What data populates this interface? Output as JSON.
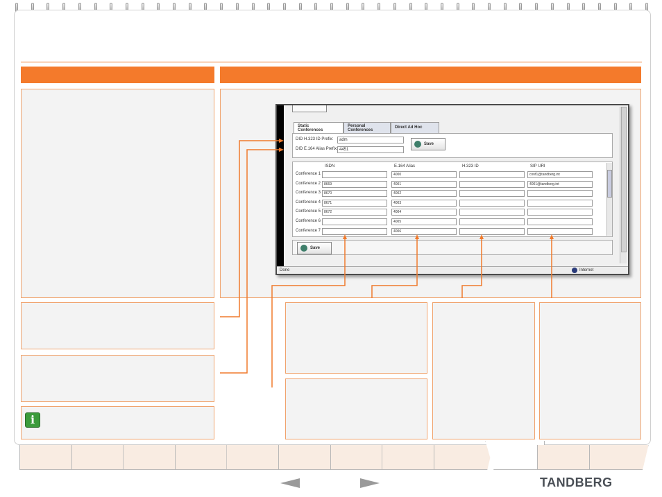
{
  "screenshot": {
    "tabs": [
      "Static\nConferences",
      "Personal\nConferences",
      "Direct Ad Hoc"
    ],
    "form": {
      "h323_label": "DID H.323 ID Prefix:",
      "h323_value": "adm",
      "e164_label": "DID E.164 Alias Prefix:",
      "e164_value": "4451"
    },
    "save_label": "Save",
    "columns": [
      "ISDN",
      "E.164 Alias",
      "H.323 ID",
      "SIP URI"
    ],
    "rows": [
      {
        "label": "Conference 1",
        "isdn": "",
        "e164": "4000",
        "h323": "",
        "sip": "conf1@tandberg.int"
      },
      {
        "label": "Conference 2",
        "isdn": "8669",
        "e164": "4001",
        "h323": "",
        "sip": "4001@tandberg.int"
      },
      {
        "label": "Conference 3",
        "isdn": "8670",
        "e164": "4002",
        "h323": "",
        "sip": ""
      },
      {
        "label": "Conference 4",
        "isdn": "8671",
        "e164": "4003",
        "h323": "",
        "sip": ""
      },
      {
        "label": "Conference 5",
        "isdn": "8672",
        "e164": "4004",
        "h323": "",
        "sip": ""
      },
      {
        "label": "Conference 6",
        "isdn": "",
        "e164": "4005",
        "h323": "",
        "sip": ""
      },
      {
        "label": "Conference 7",
        "isdn": "",
        "e164": "4006",
        "h323": "",
        "sip": ""
      }
    ],
    "status": {
      "left": "Done",
      "zone": "Internet"
    }
  },
  "footer": {
    "brand": "TANDBERG"
  },
  "colors": {
    "accent": "#f47a2b",
    "panel": "#f3f3f3",
    "panel_border": "#f0a36d",
    "link": "#2b4fb3"
  },
  "icons": {
    "info": "info-icon",
    "prev": "prev-arrow-icon",
    "next": "next-arrow-icon"
  }
}
